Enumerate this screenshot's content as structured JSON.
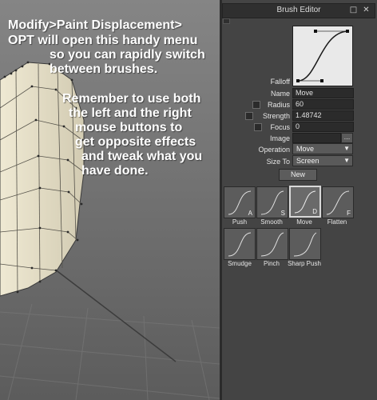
{
  "viewport": {
    "tip_lines": [
      "Modify>Paint Displacement>",
      "OPT will open this handy menu",
      "so you can rapidly switch",
      "between brushes.",
      "Remember to use both",
      "the left and the right",
      "mouse buttons to",
      "get opposite effects",
      "and tweak what you",
      "have done."
    ]
  },
  "panel": {
    "title": "Brush Editor",
    "falloff_label": "Falloff",
    "name_label": "Name",
    "name_value": "Move",
    "radius_label": "Radius",
    "radius_value": "60",
    "strength_label": "Strength",
    "strength_value": "1.48742",
    "focus_label": "Focus",
    "focus_value": "0",
    "image_label": "Image",
    "image_value": "",
    "browse_label": "...",
    "operation_label": "Operation",
    "operation_value": "Move",
    "sizeto_label": "Size To",
    "sizeto_value": "Screen",
    "new_label": "New",
    "brushes": [
      {
        "name": "Push",
        "key": "A",
        "selected": false
      },
      {
        "name": "Smooth",
        "key": "S",
        "selected": false
      },
      {
        "name": "Move",
        "key": "D",
        "selected": true
      },
      {
        "name": "Flatten",
        "key": "F",
        "selected": false
      },
      {
        "name": "Smudge",
        "key": "",
        "selected": false
      },
      {
        "name": "Pinch",
        "key": "",
        "selected": false
      },
      {
        "name": "Sharp Push",
        "key": "",
        "selected": false
      }
    ]
  },
  "colors": {
    "panel_bg": "#444444",
    "viewport_bg": "#6b6b6b",
    "mesh_face": "#e8e1c8"
  }
}
